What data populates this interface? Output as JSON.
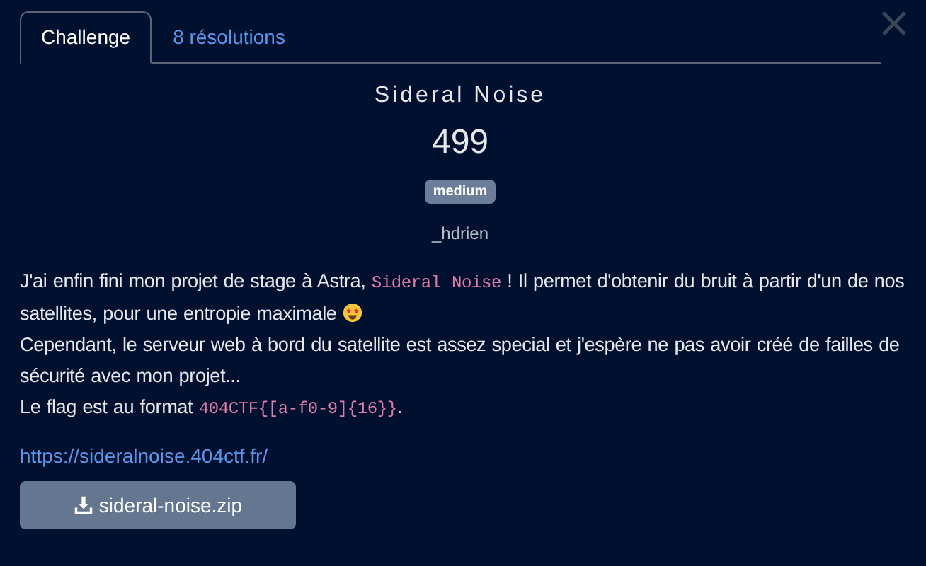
{
  "close_label": "×",
  "tabs": [
    {
      "label": "Challenge",
      "selected": true
    },
    {
      "label": "8 résolutions",
      "selected": false
    }
  ],
  "challenge": {
    "title": "Sideral Noise",
    "points": "499",
    "difficulty": "medium",
    "author": "_hdrien",
    "description": [
      [
        {
          "kind": "text",
          "text": "J'ai enfin fini mon projet de stage à Astra, "
        },
        {
          "kind": "code",
          "text": "Sideral Noise"
        },
        {
          "kind": "text",
          "text": " ! Il permet d'obtenir du bruit à partir d'un de nos satellites, pour une entropie maximale "
        },
        {
          "kind": "emoji"
        }
      ],
      [
        {
          "kind": "text",
          "text": "Cependant, le serveur web à bord du satellite est assez special et j'espère ne pas avoir créé de failles de sécurité avec mon projet..."
        }
      ],
      [
        {
          "kind": "text",
          "text": "Le flag est au format "
        },
        {
          "kind": "code",
          "text": "404CTF{[a-f0-9]{16}}"
        },
        {
          "kind": "text",
          "text": "."
        }
      ]
    ],
    "link": "https://sideralnoise.404ctf.fr/",
    "file": "sideral-noise.zip"
  }
}
